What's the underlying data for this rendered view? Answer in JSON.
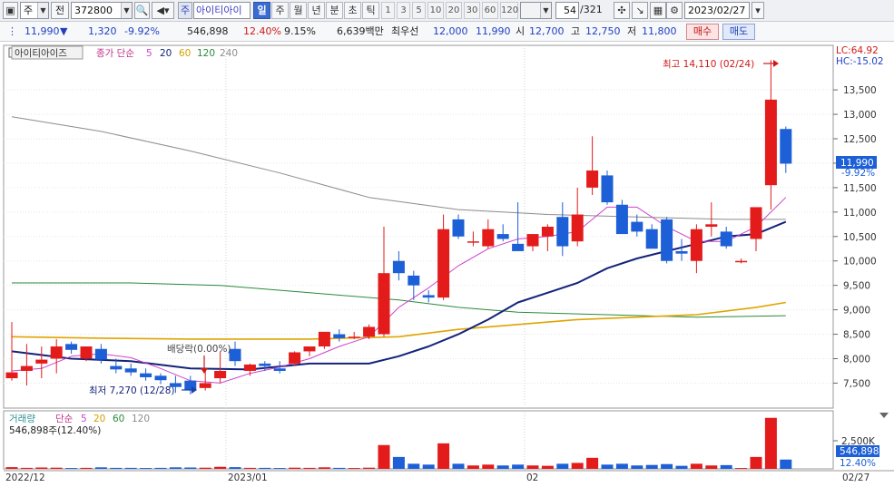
{
  "toolbar": {
    "market_select": "주",
    "prev_label": "전",
    "stock_code": "372800",
    "jongmok_badge": "주",
    "stock_name": "아이티아이",
    "periods": [
      "일",
      "주",
      "월",
      "년",
      "분",
      "초",
      "틱"
    ],
    "active_period": "일",
    "minute_options": [
      "1",
      "3",
      "5",
      "10",
      "20",
      "30",
      "60",
      "120"
    ],
    "count_current": "54",
    "count_total": "/321",
    "date": "2023/02/27",
    "icons": [
      "search-icon",
      "speaker-icon",
      "crosshair-icon",
      "chart-expand-icon",
      "save-icon",
      "settings-icon"
    ]
  },
  "quote": {
    "price": "11,990",
    "change": "1,320",
    "change_pct": "-9.92%",
    "volume": "546,898",
    "volume_pct": "12.40%",
    "turnover_pct": "9.15%",
    "amount": "6,639백만",
    "best_label": "최우선",
    "ask": "12,000",
    "bid": "11,990",
    "open_label": "시",
    "open": "12,700",
    "high_label": "고",
    "high": "12,750",
    "low_label": "저",
    "low": "11,800",
    "buy_label": "매수",
    "sell_label": "매도"
  },
  "price_panel": {
    "name_tag": "아이티아이즈",
    "ma_label": "종가 단순",
    "ma_periods": [
      "5",
      "20",
      "60",
      "120",
      "240"
    ],
    "lc_label": "LC:64.92",
    "hc_label": "HC:-15.02",
    "y_ticks": [
      "13,500",
      "13,000",
      "12,500",
      "12,000",
      "11,500",
      "11,000",
      "10,500",
      "10,000",
      "9,500",
      "9,000",
      "8,500",
      "8,000",
      "7,500"
    ],
    "current_price_tag": "11,990",
    "current_change_tag": "-9.92%",
    "high_annotation": "최고 14,110 (02/24)",
    "low_annotation": "최저 7,270 (12/28)",
    "dividend_annotation": "배당락(0.00%)"
  },
  "volume_panel": {
    "label": "거래량",
    "ma_label": "단순",
    "ma_periods": [
      "5",
      "20",
      "60",
      "120"
    ],
    "value_text": "546,898주(12.40%)",
    "y_tick": "2,500K",
    "current_volume_tag": "546,898",
    "current_pct_tag": "12.40%"
  },
  "x_axis": {
    "labels": [
      "2022/12",
      "2023/01",
      "02"
    ],
    "last_date": "02/27"
  },
  "colors": {
    "up": "#e31b1b",
    "down": "#1d5fd6",
    "ma5": "#cc44cc",
    "ma20": "#14237a",
    "ma60": "#e0a400",
    "ma120": "#2a8a3a",
    "ma240": "#8c8c8c"
  },
  "chart_data": {
    "type": "candlestick",
    "ylim": [
      7100,
      14300
    ],
    "candles": [
      {
        "d": "12/12",
        "o": 7600,
        "h": 8750,
        "l": 7550,
        "c": 7720
      },
      {
        "d": "12/13",
        "o": 7750,
        "h": 8300,
        "l": 7450,
        "c": 7850
      },
      {
        "d": "12/14",
        "o": 7900,
        "h": 8250,
        "l": 7600,
        "c": 7980
      },
      {
        "d": "12/15",
        "o": 8000,
        "h": 8400,
        "l": 7700,
        "c": 8250
      },
      {
        "d": "12/16",
        "o": 8300,
        "h": 8350,
        "l": 8100,
        "c": 8180
      },
      {
        "d": "12/19",
        "o": 8000,
        "h": 8250,
        "l": 7950,
        "c": 8250
      },
      {
        "d": "12/20",
        "o": 8200,
        "h": 8300,
        "l": 7900,
        "c": 7980
      },
      {
        "d": "12/21",
        "o": 7850,
        "h": 8000,
        "l": 7700,
        "c": 7780
      },
      {
        "d": "12/22",
        "o": 7800,
        "h": 7900,
        "l": 7650,
        "c": 7720
      },
      {
        "d": "12/23",
        "o": 7700,
        "h": 7800,
        "l": 7550,
        "c": 7620
      },
      {
        "d": "12/26",
        "o": 7650,
        "h": 7700,
        "l": 7480,
        "c": 7560
      },
      {
        "d": "12/27",
        "o": 7500,
        "h": 7650,
        "l": 7300,
        "c": 7420
      },
      {
        "d": "12/28",
        "o": 7550,
        "h": 7650,
        "l": 7270,
        "c": 7350
      },
      {
        "d": "12/29",
        "o": 7400,
        "h": 7750,
        "l": 7350,
        "c": 7500
      },
      {
        "d": "01/02",
        "o": 7600,
        "h": 8150,
        "l": 7500,
        "c": 7750
      },
      {
        "d": "01/03",
        "o": 8200,
        "h": 8350,
        "l": 7850,
        "c": 7950
      },
      {
        "d": "01/04",
        "o": 7750,
        "h": 7900,
        "l": 7650,
        "c": 7880
      },
      {
        "d": "01/05",
        "o": 7900,
        "h": 7950,
        "l": 7750,
        "c": 7850
      },
      {
        "d": "01/06",
        "o": 7800,
        "h": 7950,
        "l": 7700,
        "c": 7750
      },
      {
        "d": "01/09",
        "o": 7900,
        "h": 8150,
        "l": 7850,
        "c": 8130
      },
      {
        "d": "01/10",
        "o": 8150,
        "h": 8250,
        "l": 8050,
        "c": 8250
      },
      {
        "d": "01/11",
        "o": 8250,
        "h": 8550,
        "l": 8200,
        "c": 8550
      },
      {
        "d": "01/12",
        "o": 8500,
        "h": 8600,
        "l": 8350,
        "c": 8420
      },
      {
        "d": "01/13",
        "o": 8450,
        "h": 8550,
        "l": 8400,
        "c": 8450
      },
      {
        "d": "01/16",
        "o": 8450,
        "h": 8700,
        "l": 8400,
        "c": 8650
      },
      {
        "d": "01/17",
        "o": 8500,
        "h": 10700,
        "l": 8450,
        "c": 9750
      },
      {
        "d": "01/18",
        "o": 10000,
        "h": 10200,
        "l": 9600,
        "c": 9750
      },
      {
        "d": "01/19",
        "o": 9700,
        "h": 9800,
        "l": 9200,
        "c": 9500
      },
      {
        "d": "01/20",
        "o": 9300,
        "h": 9400,
        "l": 9150,
        "c": 9250
      },
      {
        "d": "01/25",
        "o": 9250,
        "h": 10950,
        "l": 9200,
        "c": 10650
      },
      {
        "d": "01/26",
        "o": 10850,
        "h": 10950,
        "l": 10450,
        "c": 10500
      },
      {
        "d": "01/27",
        "o": 10400,
        "h": 10600,
        "l": 10300,
        "c": 10400
      },
      {
        "d": "01/30",
        "o": 10300,
        "h": 10850,
        "l": 10250,
        "c": 10650
      },
      {
        "d": "01/31",
        "o": 10550,
        "h": 10750,
        "l": 10400,
        "c": 10450
      },
      {
        "d": "02/01",
        "o": 10350,
        "h": 11200,
        "l": 10300,
        "c": 10200
      },
      {
        "d": "02/02",
        "o": 10300,
        "h": 10550,
        "l": 10200,
        "c": 10550
      },
      {
        "d": "02/03",
        "o": 10500,
        "h": 10750,
        "l": 10200,
        "c": 10700
      },
      {
        "d": "02/06",
        "o": 10900,
        "h": 11200,
        "l": 10100,
        "c": 10300
      },
      {
        "d": "02/07",
        "o": 10400,
        "h": 11500,
        "l": 10300,
        "c": 10950
      },
      {
        "d": "02/08",
        "o": 11500,
        "h": 12550,
        "l": 11350,
        "c": 11850
      },
      {
        "d": "02/09",
        "o": 11750,
        "h": 11850,
        "l": 11150,
        "c": 11200
      },
      {
        "d": "02/10",
        "o": 11150,
        "h": 11250,
        "l": 10900,
        "c": 10550
      },
      {
        "d": "02/13",
        "o": 10800,
        "h": 10950,
        "l": 10500,
        "c": 10600
      },
      {
        "d": "02/14",
        "o": 10650,
        "h": 10750,
        "l": 10300,
        "c": 10250
      },
      {
        "d": "02/15",
        "o": 10850,
        "h": 10900,
        "l": 9950,
        "c": 10000
      },
      {
        "d": "02/16",
        "o": 10200,
        "h": 10450,
        "l": 10000,
        "c": 10150
      },
      {
        "d": "02/17",
        "o": 10000,
        "h": 10750,
        "l": 9750,
        "c": 10650
      },
      {
        "d": "02/20",
        "o": 10700,
        "h": 11200,
        "l": 10500,
        "c": 10750
      },
      {
        "d": "02/21",
        "o": 10600,
        "h": 10700,
        "l": 10250,
        "c": 10300
      },
      {
        "d": "02/22",
        "o": 10000,
        "h": 10050,
        "l": 9950,
        "c": 10000
      },
      {
        "d": "02/23",
        "o": 10450,
        "h": 11100,
        "l": 10200,
        "c": 11100
      },
      {
        "d": "02/24",
        "o": 11550,
        "h": 14110,
        "l": 11050,
        "c": 13300
      },
      {
        "d": "02/27",
        "o": 12700,
        "h": 12750,
        "l": 11800,
        "c": 11990
      }
    ],
    "ma5": [
      [
        0,
        7750
      ],
      [
        2,
        7800
      ],
      [
        4,
        8050
      ],
      [
        6,
        8100
      ],
      [
        8,
        8020
      ],
      [
        10,
        7800
      ],
      [
        12,
        7550
      ],
      [
        14,
        7500
      ],
      [
        16,
        7700
      ],
      [
        18,
        7830
      ],
      [
        20,
        8000
      ],
      [
        22,
        8250
      ],
      [
        24,
        8450
      ],
      [
        26,
        9050
      ],
      [
        28,
        9450
      ],
      [
        30,
        9900
      ],
      [
        32,
        10250
      ],
      [
        34,
        10450
      ],
      [
        36,
        10500
      ],
      [
        38,
        10600
      ],
      [
        40,
        11100
      ],
      [
        42,
        11100
      ],
      [
        44,
        10700
      ],
      [
        46,
        10400
      ],
      [
        48,
        10400
      ],
      [
        50,
        10700
      ],
      [
        52,
        11300
      ]
    ],
    "ma20": [
      [
        0,
        8150
      ],
      [
        4,
        8000
      ],
      [
        8,
        7950
      ],
      [
        12,
        7800
      ],
      [
        16,
        7780
      ],
      [
        20,
        7900
      ],
      [
        24,
        7900
      ],
      [
        26,
        8050
      ],
      [
        28,
        8250
      ],
      [
        30,
        8500
      ],
      [
        32,
        8800
      ],
      [
        34,
        9150
      ],
      [
        36,
        9350
      ],
      [
        38,
        9550
      ],
      [
        40,
        9850
      ],
      [
        42,
        10050
      ],
      [
        44,
        10200
      ],
      [
        46,
        10350
      ],
      [
        48,
        10500
      ],
      [
        50,
        10550
      ],
      [
        52,
        10800
      ]
    ],
    "ma60": [
      [
        0,
        8450
      ],
      [
        6,
        8420
      ],
      [
        12,
        8400
      ],
      [
        20,
        8400
      ],
      [
        26,
        8450
      ],
      [
        30,
        8600
      ],
      [
        34,
        8700
      ],
      [
        38,
        8800
      ],
      [
        42,
        8850
      ],
      [
        46,
        8900
      ],
      [
        50,
        9050
      ],
      [
        52,
        9150
      ]
    ],
    "ma120": [
      [
        0,
        9550
      ],
      [
        8,
        9550
      ],
      [
        14,
        9500
      ],
      [
        20,
        9350
      ],
      [
        26,
        9200
      ],
      [
        30,
        9050
      ],
      [
        34,
        8950
      ],
      [
        40,
        8900
      ],
      [
        46,
        8850
      ],
      [
        52,
        8880
      ]
    ],
    "ma240": [
      [
        0,
        12950
      ],
      [
        6,
        12650
      ],
      [
        12,
        12250
      ],
      [
        18,
        11800
      ],
      [
        24,
        11300
      ],
      [
        30,
        11050
      ],
      [
        36,
        10950
      ],
      [
        42,
        10900
      ],
      [
        48,
        10850
      ],
      [
        52,
        10850
      ]
    ],
    "volume_ylim": [
      0,
      3200
    ],
    "volume_tick": 2500,
    "volumes": [
      100,
      60,
      80,
      70,
      50,
      60,
      90,
      60,
      60,
      50,
      60,
      90,
      80,
      70,
      120,
      100,
      60,
      60,
      50,
      70,
      60,
      90,
      60,
      50,
      70,
      1400,
      700,
      300,
      250,
      1500,
      300,
      200,
      250,
      200,
      250,
      200,
      180,
      300,
      350,
      650,
      250,
      300,
      200,
      230,
      280,
      180,
      300,
      200,
      220,
      50,
      700,
      3000,
      547
    ]
  }
}
